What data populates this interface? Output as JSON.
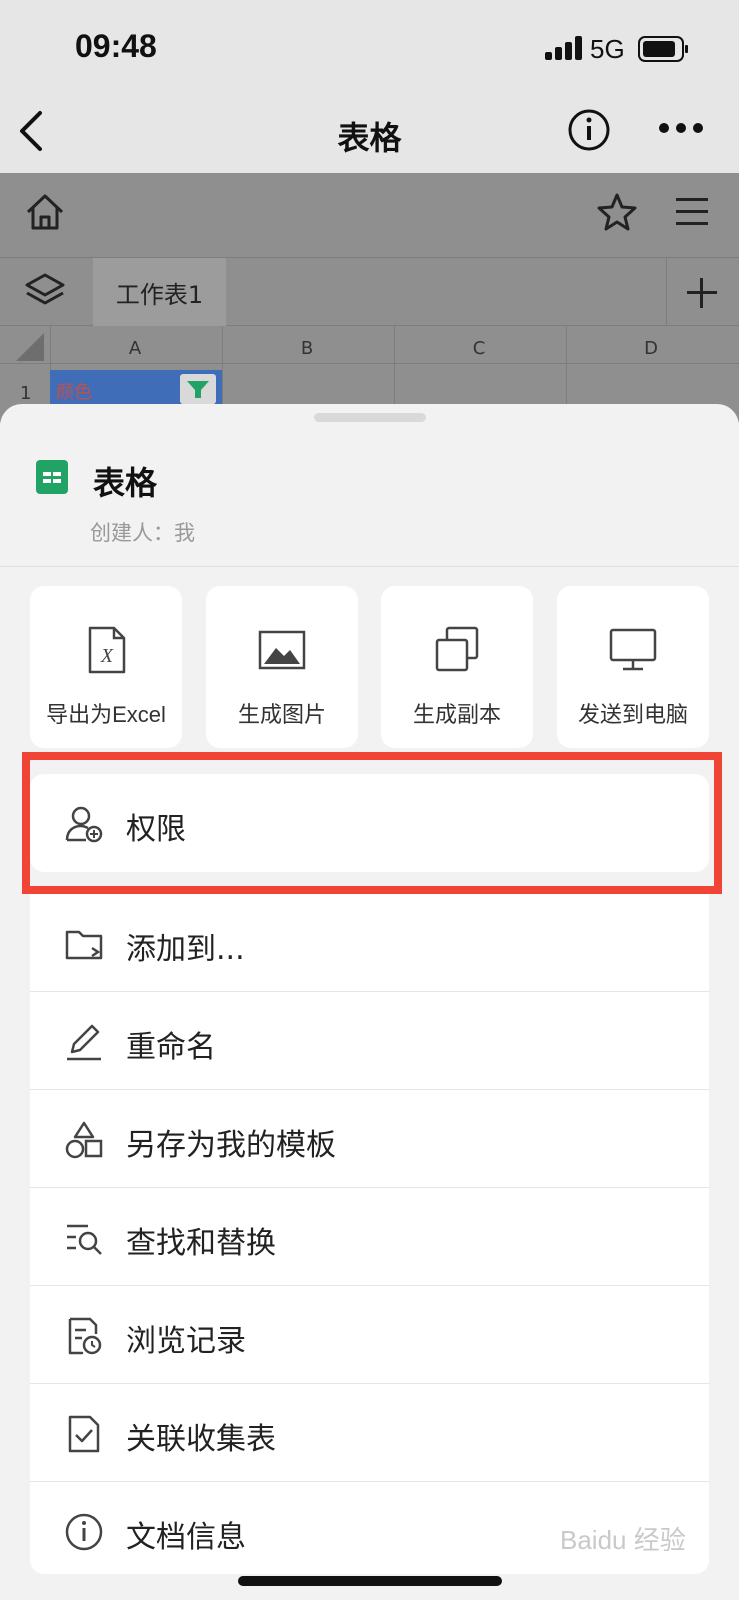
{
  "status_bar": {
    "time": "09:48",
    "network": "5G"
  },
  "nav": {
    "title": "表格"
  },
  "sheet": {
    "tab_name": "工作表1",
    "columns": [
      "A",
      "B",
      "C",
      "D"
    ],
    "row_number": "1",
    "cell_a1": "颜色"
  },
  "panel": {
    "doc_title": "表格",
    "creator": "创建人：我",
    "actions": [
      {
        "label": "导出为Excel",
        "icon": "excel-file-icon"
      },
      {
        "label": "生成图片",
        "icon": "image-icon"
      },
      {
        "label": "生成副本",
        "icon": "copy-icon"
      },
      {
        "label": "发送到电脑",
        "icon": "monitor-icon"
      }
    ],
    "menu": [
      {
        "label": "权限",
        "icon": "user-add-icon"
      },
      {
        "label": "添加到...",
        "icon": "folder-move-icon"
      },
      {
        "label": "重命名",
        "icon": "pencil-icon"
      },
      {
        "label": "另存为我的模板",
        "icon": "shapes-icon"
      },
      {
        "label": "查找和替换",
        "icon": "search-list-icon"
      },
      {
        "label": "浏览记录",
        "icon": "history-doc-icon"
      },
      {
        "label": "关联收集表",
        "icon": "check-doc-icon"
      },
      {
        "label": "文档信息",
        "icon": "info-icon"
      }
    ]
  },
  "colors": {
    "highlight": "#f04536",
    "sheet_green": "#21a366",
    "cell_blue": "#3f6db7"
  },
  "watermark": "Baidu 经验"
}
